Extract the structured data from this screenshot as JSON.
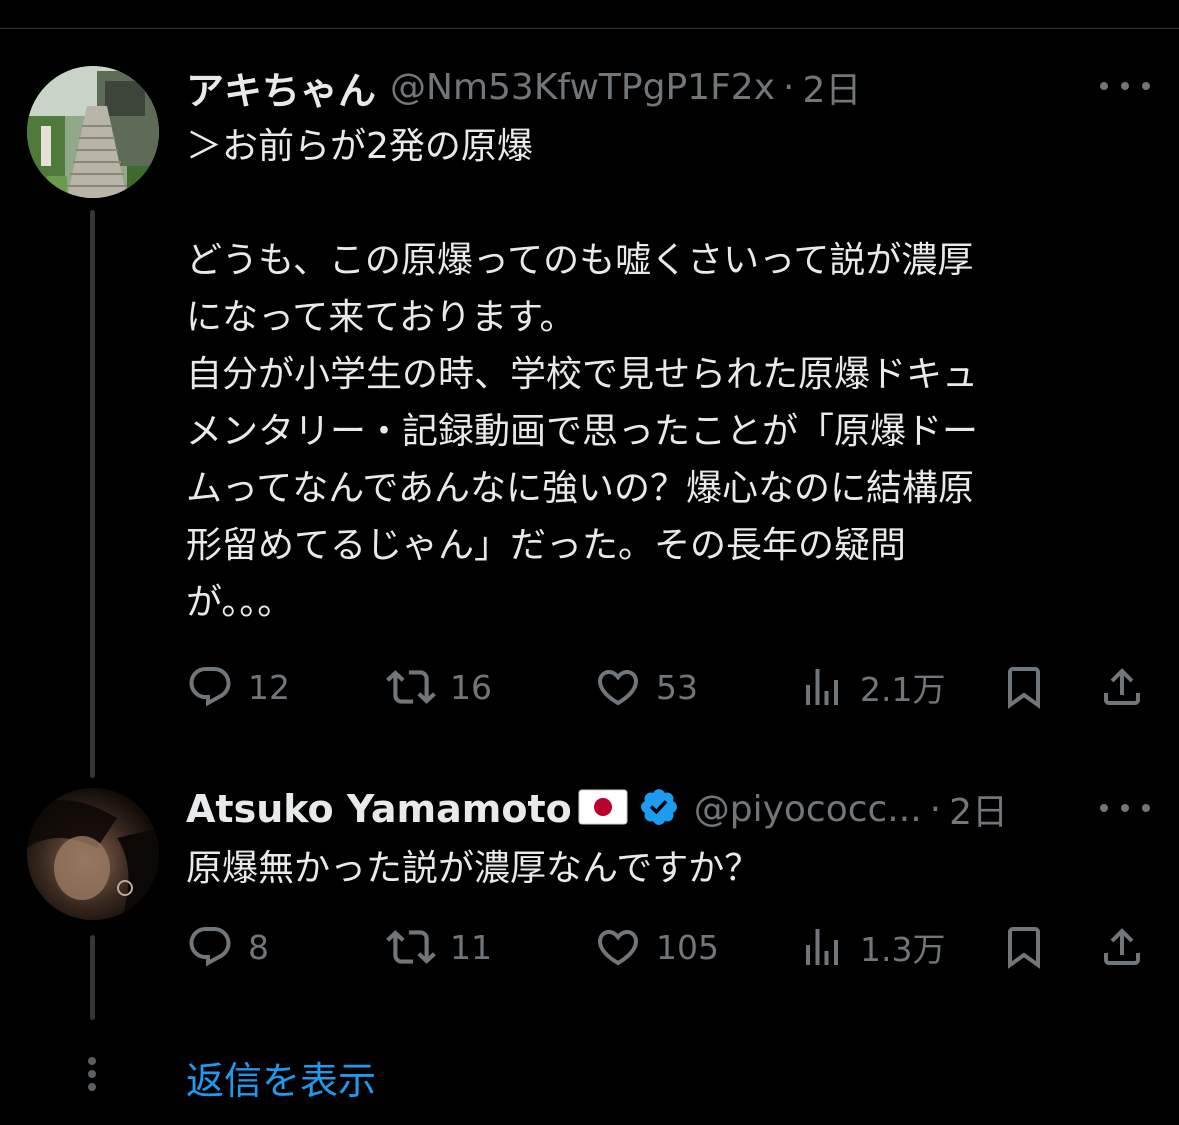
{
  "tweets": [
    {
      "name": "アキちゃん",
      "handle": "@Nm53KfwTPgP1F2x",
      "dot": "·",
      "time": "2日",
      "text": "＞お前らが2発の原爆\n\nどうも、この原爆ってのも嘘くさいって説が濃厚\nになって来ております。\n自分が小学生の時、学校で見せられた原爆ドキュ\nメンタリー・記録動画で思ったことが「原爆ドー\nムってなんであんなに強いの？爆心なのに結構原\n形留めてるじゃん」だった。その長年の疑問\nが。。。",
      "replies": "12",
      "retweets": "16",
      "likes": "53",
      "views": "2.1万"
    },
    {
      "name": "Atsuko Yamamoto",
      "handle": "@piyococc...",
      "dot": "·",
      "time": "2日",
      "text": "原爆無かった説が濃厚なんですか？",
      "replies": "8",
      "retweets": "11",
      "likes": "105",
      "views": "1.3万"
    }
  ],
  "show_replies": "返信を表示",
  "colors": {
    "background": "#000000",
    "text": "#e7e9ea",
    "muted": "#71767b",
    "accent": "#1d9bf0"
  }
}
